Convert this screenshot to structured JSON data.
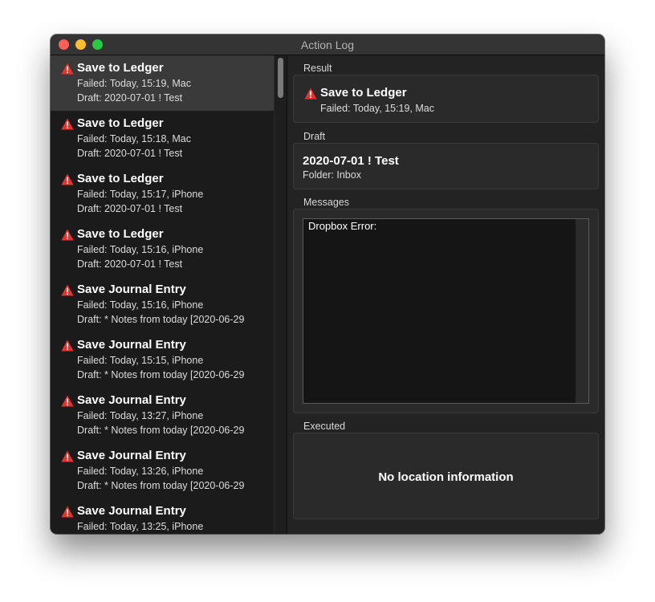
{
  "window": {
    "title": "Action Log"
  },
  "log": [
    {
      "action": "Save to Ledger",
      "status": "Failed: Today, 15:19, Mac",
      "draft": "Draft: 2020-07-01 ! Test",
      "selected": true
    },
    {
      "action": "Save to Ledger",
      "status": "Failed: Today, 15:18, Mac",
      "draft": "Draft: 2020-07-01 ! Test"
    },
    {
      "action": "Save to Ledger",
      "status": "Failed: Today, 15:17, iPhone",
      "draft": "Draft: 2020-07-01 ! Test"
    },
    {
      "action": "Save to Ledger",
      "status": "Failed: Today, 15:16, iPhone",
      "draft": "Draft: 2020-07-01 ! Test"
    },
    {
      "action": "Save Journal Entry",
      "status": "Failed: Today, 15:16, iPhone",
      "draft": "Draft: * Notes from today [2020-06-29"
    },
    {
      "action": "Save Journal Entry",
      "status": "Failed: Today, 15:15, iPhone",
      "draft": "Draft: * Notes from today [2020-06-29"
    },
    {
      "action": "Save Journal Entry",
      "status": "Failed: Today, 13:27, iPhone",
      "draft": "Draft: * Notes from today [2020-06-29"
    },
    {
      "action": "Save Journal Entry",
      "status": "Failed: Today, 13:26, iPhone",
      "draft": "Draft: * Notes from today [2020-06-29"
    },
    {
      "action": "Save Journal Entry",
      "status": "Failed: Today, 13:25, iPhone",
      "draft": ""
    }
  ],
  "result": {
    "label": "Result",
    "action": "Save to Ledger",
    "status": "Failed: Today, 15:19, Mac"
  },
  "draft": {
    "label": "Draft",
    "title": "2020-07-01 ! Test",
    "folder": "Folder: Inbox"
  },
  "messages": {
    "label": "Messages",
    "text": "Dropbox Error:"
  },
  "executed": {
    "label": "Executed",
    "empty_text": "No location information"
  },
  "colors": {
    "warning": "#e8322d",
    "selected_row": "#3a3a3a",
    "window_bg": "#232323"
  },
  "icons": {
    "status": "warning-triangle-icon"
  }
}
